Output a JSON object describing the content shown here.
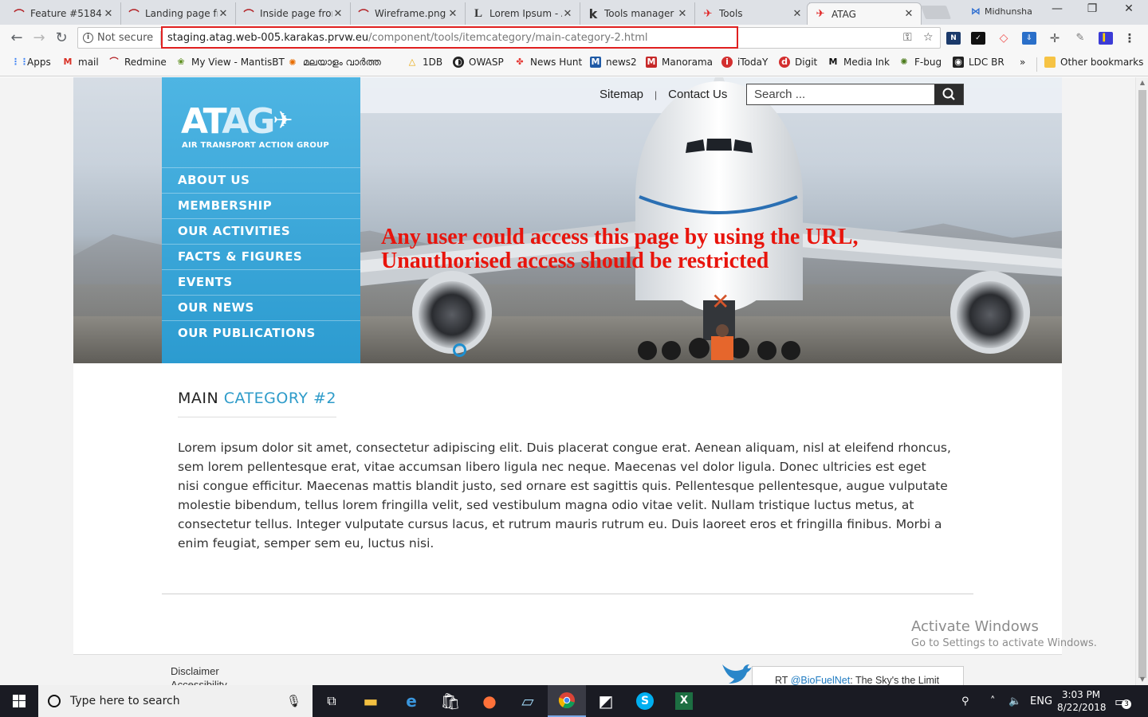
{
  "browser": {
    "tabs": [
      {
        "title": "Feature #5184:",
        "icon": "redmine-icon",
        "color": "#b32024"
      },
      {
        "title": "Landing page fr",
        "icon": "redmine-icon",
        "color": "#b32024"
      },
      {
        "title": "Inside page fron",
        "icon": "redmine-icon",
        "color": "#b32024"
      },
      {
        "title": "Wireframe.png",
        "icon": "redmine-icon",
        "color": "#b32024"
      },
      {
        "title": "Lorem Ipsum - A",
        "icon": "lorem-ipsum-icon",
        "color": "#222222"
      },
      {
        "title": "Tools manager",
        "icon": "k-icon",
        "color": "#111111"
      },
      {
        "title": "Tools",
        "icon": "plane-icon",
        "color": "#e02020"
      },
      {
        "title": "ATAG",
        "icon": "plane-icon",
        "color": "#e02020"
      }
    ],
    "profile_name": "Midhunsha",
    "security_label": "Not secure",
    "url_host": "staging.atag.web-005.karakas.prvw.eu",
    "url_path": "/component/tools/itemcategory/main-category-2.html",
    "bookmarks": [
      {
        "label": "Apps"
      },
      {
        "label": "mail"
      },
      {
        "label": "Redmine"
      },
      {
        "label": "My View - MantisBT"
      },
      {
        "label": "മലയാളം വാർത്ത"
      },
      {
        "label": "1DB"
      },
      {
        "label": "OWASP"
      },
      {
        "label": "News Hunt"
      },
      {
        "label": "news2"
      },
      {
        "label": "Manorama"
      },
      {
        "label": "iTodaY"
      },
      {
        "label": "Digit"
      },
      {
        "label": "Media Ink"
      },
      {
        "label": "F-bug"
      },
      {
        "label": "LDC BR"
      }
    ],
    "overflow_label": "»",
    "other_bookmarks": "Other bookmarks"
  },
  "site": {
    "logo_text": "ATAG",
    "logo_subtitle": "AIR TRANSPORT ACTION GROUP",
    "nav": [
      "ABOUT US",
      "MEMBERSHIP",
      "OUR ACTIVITIES",
      "FACTS & FIGURES",
      "EVENTS",
      "OUR NEWS",
      "OUR PUBLICATIONS"
    ],
    "top_links": {
      "sitemap": "Sitemap",
      "separator": "|",
      "contact": "Contact Us"
    },
    "search_placeholder": "Search ...",
    "annotation": {
      "line1": "Any user could access this page by using the URL,",
      "line2": "Unauthorised access should be restricted"
    },
    "title_main": "MAIN",
    "title_accent": "CATEGORY #2",
    "body_text": "Lorem ipsum dolor sit amet, consectetur adipiscing elit. Duis placerat congue erat. Aenean aliquam, nisl at eleifend rhoncus, sem lorem pellentesque erat, vitae accumsan libero ligula nec neque. Maecenas vel dolor ligula. Donec ultricies est eget nisi congue efficitur. Maecenas mattis blandit justo, sed ornare est sagittis quis. Pellentesque pellentesque, augue vulputate molestie bibendum, tellus lorem fringilla velit, sed vestibulum magna odio vitae velit. Nullam tristique luctus metus, at consectetur tellus. Integer vulputate cursus lacus, et rutrum mauris rutrum eu. Duis laoreet eros et fringilla finibus. Morbi a enim feugiat, semper sem eu, luctus nisi.",
    "footer": {
      "disclaimer": "Disclaimer",
      "accessibility": "Accessibility",
      "tweet_prefix": "RT ",
      "tweet_handle": "@BioFuelNet",
      "tweet_text": ": The Sky's the Limit"
    }
  },
  "watermark": {
    "line1": "Activate Windows",
    "line2": "Go to Settings to activate Windows."
  },
  "taskbar": {
    "search_placeholder": "Type here to search",
    "language": "ENG",
    "time": "3:03 PM",
    "date": "8/22/2018",
    "notification_count": "3"
  },
  "colors": {
    "accent": "#2d9bc9",
    "sidebar": "#3aa8da",
    "annotation": "#e8140c",
    "highlight": "#e02020"
  }
}
